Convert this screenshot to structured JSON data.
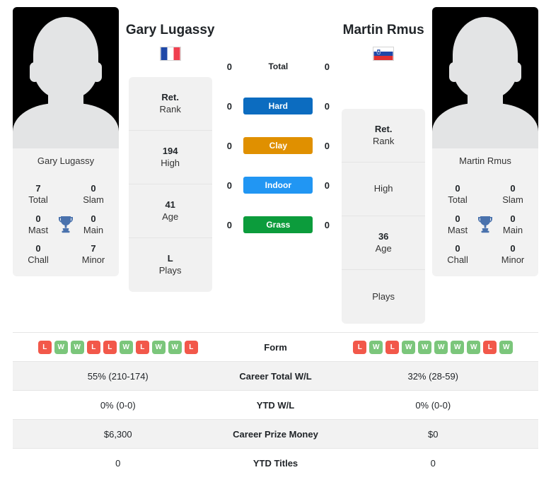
{
  "colors": {
    "hard": "#0c6cc0",
    "clay": "#e09000",
    "indoor": "#2196f3",
    "grass": "#0c9c3c",
    "win": "#7bc67b",
    "loss": "#f2584a",
    "trophy": "#4a72ad"
  },
  "players": {
    "left": {
      "name": "Gary Lugassy",
      "photo_caption": "Gary Lugassy",
      "country": "France",
      "flag_icon": "flag-france",
      "titles": [
        {
          "value": "7",
          "label": "Total"
        },
        {
          "value": "0",
          "label": "Slam"
        },
        {
          "value": "0",
          "label": "Mast"
        },
        {
          "value": "0",
          "label": "Main"
        },
        {
          "value": "0",
          "label": "Chall"
        },
        {
          "value": "7",
          "label": "Minor"
        }
      ],
      "info": [
        {
          "value": "Ret.",
          "label": "Rank"
        },
        {
          "value": "194",
          "label": "High"
        },
        {
          "value": "41",
          "label": "Age"
        },
        {
          "value": "L",
          "label": "Plays"
        }
      ]
    },
    "right": {
      "name": "Martin Rmus",
      "photo_caption": "Martin Rmus",
      "country": "Slovenia",
      "flag_icon": "flag-slovenia",
      "titles": [
        {
          "value": "0",
          "label": "Total"
        },
        {
          "value": "0",
          "label": "Slam"
        },
        {
          "value": "0",
          "label": "Mast"
        },
        {
          "value": "0",
          "label": "Main"
        },
        {
          "value": "0",
          "label": "Chall"
        },
        {
          "value": "0",
          "label": "Minor"
        }
      ],
      "info": [
        {
          "value": "Ret.",
          "label": "Rank"
        },
        {
          "value": "",
          "label": "High"
        },
        {
          "value": "36",
          "label": "Age"
        },
        {
          "value": "",
          "label": "Plays"
        }
      ]
    }
  },
  "h2h": [
    {
      "left": "0",
      "label": "Total",
      "right": "0",
      "style": "plain"
    },
    {
      "left": "0",
      "label": "Hard",
      "right": "0",
      "style": "hard"
    },
    {
      "left": "0",
      "label": "Clay",
      "right": "0",
      "style": "clay"
    },
    {
      "left": "0",
      "label": "Indoor",
      "right": "0",
      "style": "indoor"
    },
    {
      "left": "0",
      "label": "Grass",
      "right": "0",
      "style": "grass"
    }
  ],
  "stats_table": {
    "rows": [
      {
        "label": "Form",
        "type": "form",
        "left_form": [
          "L",
          "W",
          "W",
          "L",
          "L",
          "W",
          "L",
          "W",
          "W",
          "L"
        ],
        "right_form": [
          "L",
          "W",
          "L",
          "W",
          "W",
          "W",
          "W",
          "W",
          "L",
          "W"
        ],
        "shaded": false
      },
      {
        "label": "Career Total W/L",
        "type": "text",
        "left": "55% (210-174)",
        "right": "32% (28-59)",
        "shaded": true
      },
      {
        "label": "YTD W/L",
        "type": "text",
        "left": "0% (0-0)",
        "right": "0% (0-0)",
        "shaded": false
      },
      {
        "label": "Career Prize Money",
        "type": "text",
        "left": "$6,300",
        "right": "$0",
        "shaded": true
      },
      {
        "label": "YTD Titles",
        "type": "text",
        "left": "0",
        "right": "0",
        "shaded": false
      }
    ]
  }
}
